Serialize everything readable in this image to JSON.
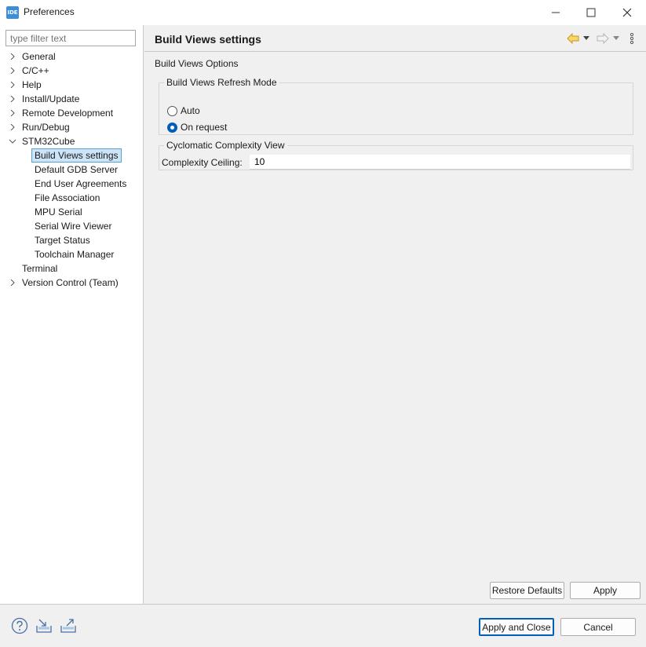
{
  "window": {
    "title": "Preferences",
    "icon_text": "IDE",
    "controls": [
      "minimize-icon",
      "maximize-icon",
      "close-icon"
    ]
  },
  "sidebar": {
    "filter_placeholder": "type filter text",
    "items": [
      {
        "label": "General",
        "expander": "collapsed"
      },
      {
        "label": "C/C++",
        "expander": "collapsed"
      },
      {
        "label": "Help",
        "expander": "collapsed"
      },
      {
        "label": "Install/Update",
        "expander": "collapsed"
      },
      {
        "label": "Remote Development",
        "expander": "collapsed"
      },
      {
        "label": "Run/Debug",
        "expander": "collapsed"
      },
      {
        "label": "STM32Cube",
        "expander": "expanded"
      },
      {
        "label": "Build Views settings",
        "child": true,
        "selected": true
      },
      {
        "label": "Default GDB Server",
        "child": true
      },
      {
        "label": "End User Agreements",
        "child": true
      },
      {
        "label": "File Association",
        "child": true
      },
      {
        "label": "MPU Serial",
        "child": true
      },
      {
        "label": "Serial Wire Viewer",
        "child": true
      },
      {
        "label": "Target Status",
        "child": true
      },
      {
        "label": "Toolchain Manager",
        "child": true
      },
      {
        "label": "Terminal",
        "expander": "none"
      },
      {
        "label": "Version Control (Team)",
        "expander": "collapsed"
      }
    ]
  },
  "page": {
    "title": "Build Views settings",
    "section": "Build Views Options",
    "refresh_group": {
      "label": "Build Views Refresh Mode",
      "options": [
        {
          "label": "Auto",
          "checked": false
        },
        {
          "label": "On request",
          "checked": true
        }
      ]
    },
    "complexity_group": {
      "label": "Cyclomatic Complexity View",
      "field_label": "Complexity Ceiling:",
      "field_value": "10"
    },
    "restore_defaults_label": "Restore Defaults",
    "apply_label": "Apply"
  },
  "footer": {
    "apply_close_label": "Apply and Close",
    "cancel_label": "Cancel",
    "icons": [
      "help-icon",
      "import-icon",
      "export-icon"
    ]
  },
  "colors": {
    "accent": "#005fb8",
    "selection_bg": "#cce4f7",
    "nav_arrow": "#e0a820"
  }
}
